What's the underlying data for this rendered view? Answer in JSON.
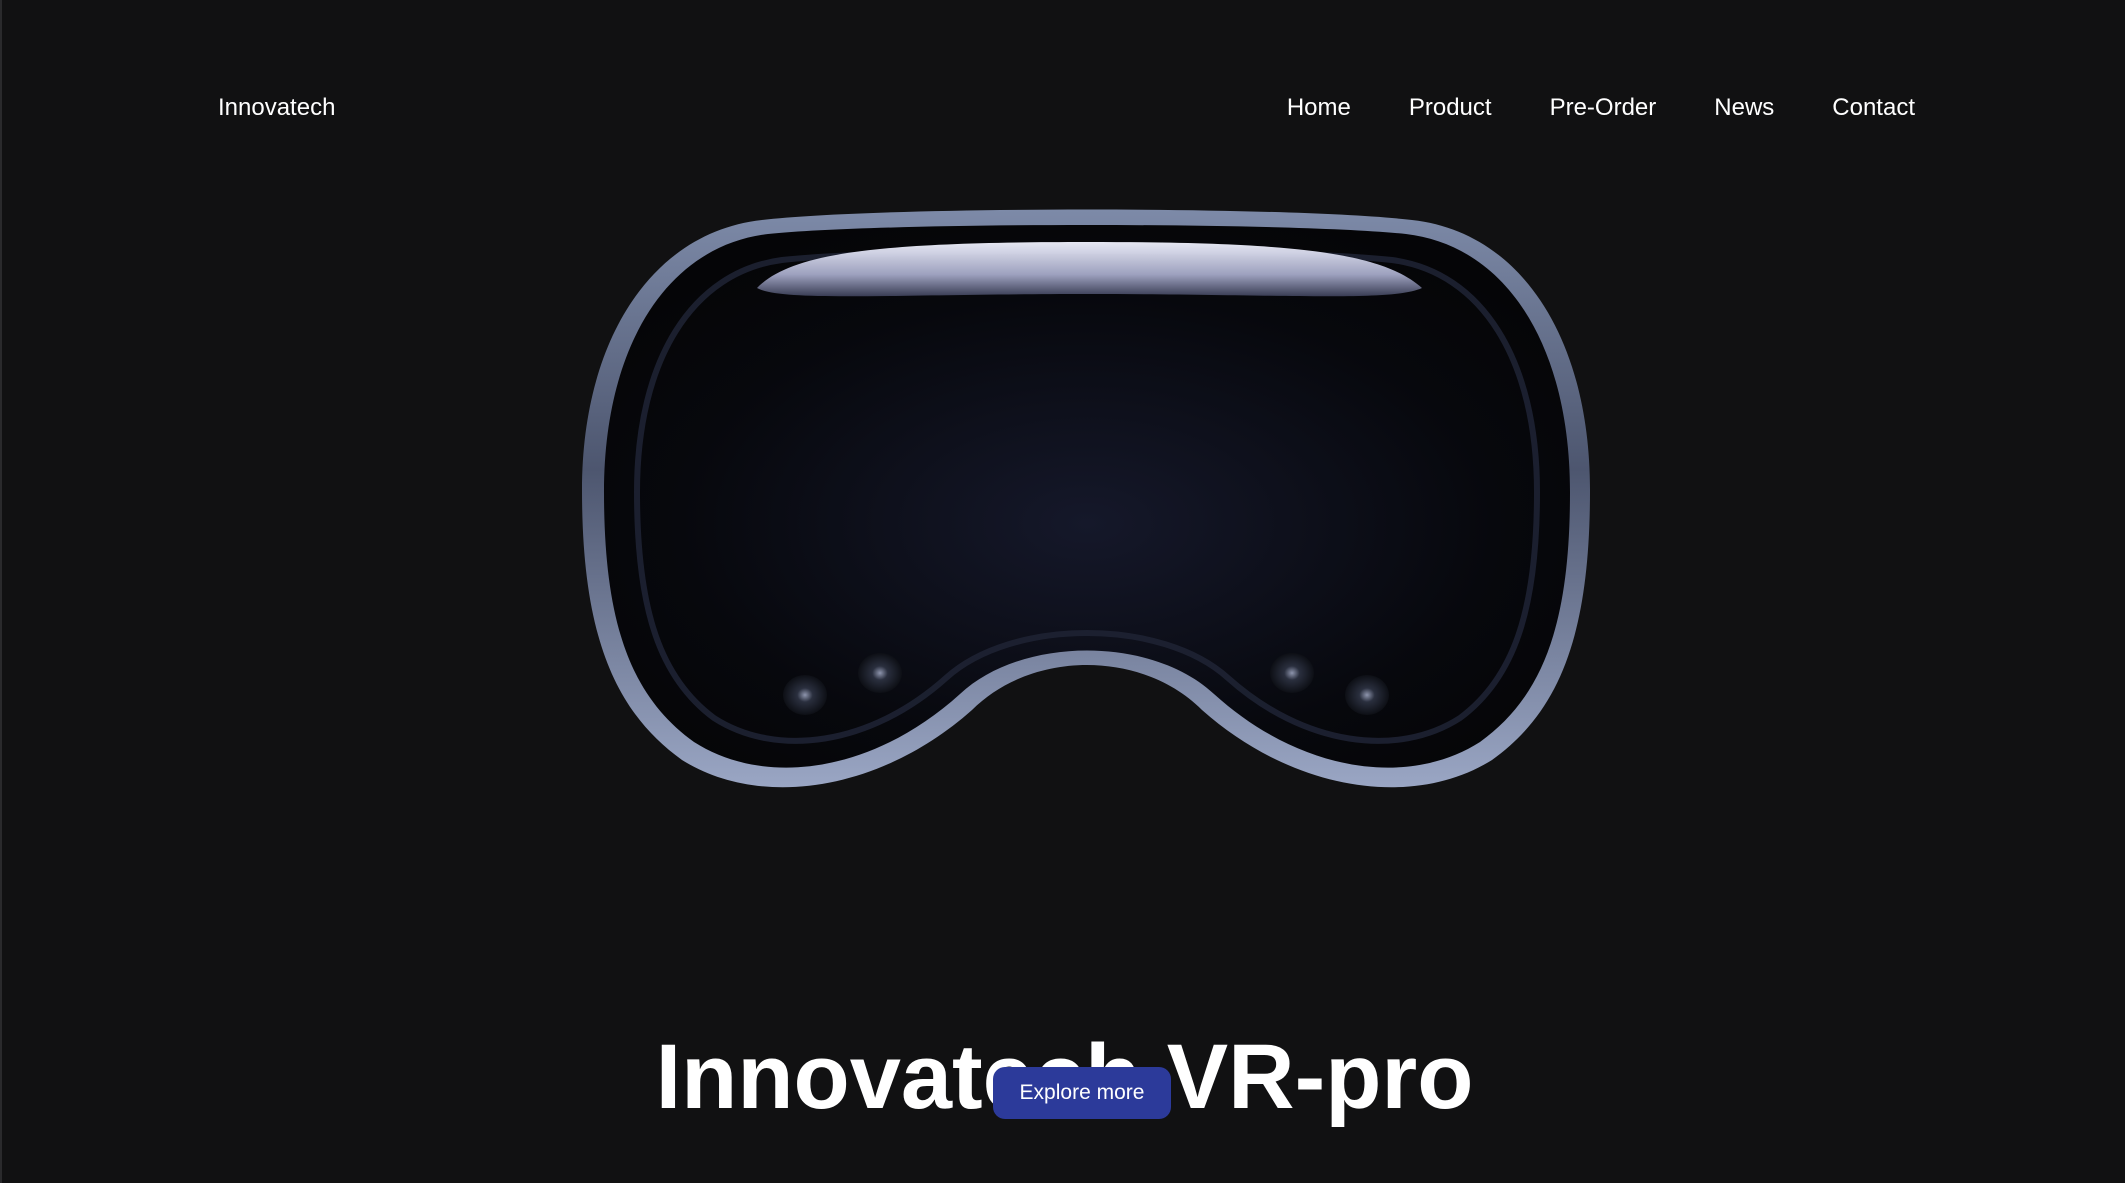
{
  "header": {
    "brand": "Innovatech",
    "nav": [
      {
        "label": "Home"
      },
      {
        "label": "Product"
      },
      {
        "label": "Pre-Order"
      },
      {
        "label": "News"
      },
      {
        "label": "Contact"
      }
    ]
  },
  "hero": {
    "image_icon": "vr-headset-icon",
    "title": "Innovatech VR-pro",
    "cta_label": "Explore more"
  },
  "colors": {
    "background": "#111112",
    "accent": "#2c3a9a",
    "text": "#ffffff"
  }
}
